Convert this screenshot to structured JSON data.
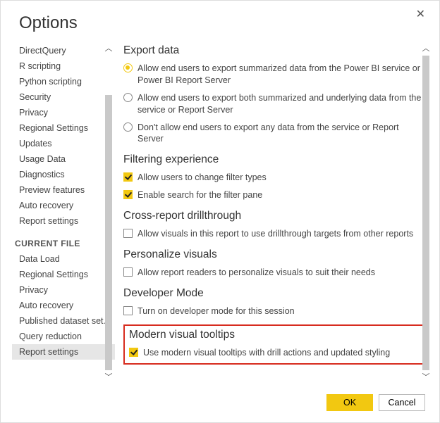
{
  "dialog": {
    "title": "Options"
  },
  "sidebar": {
    "items": {
      "directquery": "DirectQuery",
      "r_scripting": "R scripting",
      "python_scripting": "Python scripting",
      "security": "Security",
      "privacy": "Privacy",
      "regional_settings": "Regional Settings",
      "updates": "Updates",
      "usage_data": "Usage Data",
      "diagnostics": "Diagnostics",
      "preview_features": "Preview features",
      "auto_recovery": "Auto recovery",
      "report_settings": "Report settings"
    },
    "section_header": "CURRENT FILE",
    "current_file": {
      "data_load": "Data Load",
      "regional_settings": "Regional Settings",
      "privacy": "Privacy",
      "auto_recovery": "Auto recovery",
      "published_dataset": "Published dataset set…",
      "query_reduction": "Query reduction",
      "report_settings": "Report settings"
    }
  },
  "content": {
    "export": {
      "title": "Export data",
      "opt1": "Allow end users to export summarized data from the Power BI service or Power BI Report Server",
      "opt2": "Allow end users to export both summarized and underlying data from the service or Report Server",
      "opt3": "Don't allow end users to export any data from the service or Report Server"
    },
    "filtering": {
      "title": "Filtering experience",
      "opt1": "Allow users to change filter types",
      "opt2": "Enable search for the filter pane"
    },
    "crossreport": {
      "title": "Cross-report drillthrough",
      "opt1": "Allow visuals in this report to use drillthrough targets from other reports"
    },
    "personalize": {
      "title": "Personalize visuals",
      "opt1": "Allow report readers to personalize visuals to suit their needs"
    },
    "devmode": {
      "title": "Developer Mode",
      "opt1": "Turn on developer mode for this session"
    },
    "tooltips": {
      "title": "Modern visual tooltips",
      "opt1": "Use modern visual tooltips with drill actions and updated styling"
    }
  },
  "buttons": {
    "ok": "OK",
    "cancel": "Cancel"
  }
}
